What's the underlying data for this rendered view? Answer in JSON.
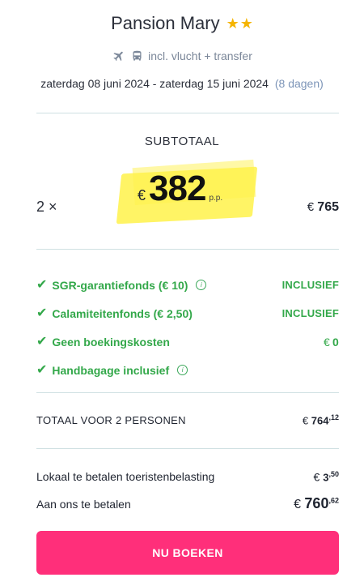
{
  "hotel": {
    "name": "Pansion Mary",
    "stars": 2,
    "star_color": "#f5b400"
  },
  "travel": {
    "icons": [
      "airplane-icon",
      "bus-icon"
    ],
    "label": "incl. vlucht + transfer"
  },
  "dates": {
    "range": "zaterdag 08 juni 2024 - zaterdag 15 juni 2024",
    "duration": "(8 dagen)"
  },
  "subtotal": {
    "label": "SUBTOTAAL",
    "quantity": "2 ×",
    "currency": "€",
    "price_pp": "382",
    "unit": "p.p.",
    "line_total_currency": "€",
    "line_total": "765"
  },
  "features": [
    {
      "label": "SGR-garantiefonds (€ 10)",
      "info": true,
      "value": "INCLUSIEF"
    },
    {
      "label": "Calamiteitenfonds (€ 2,50)",
      "info": false,
      "value": "INCLUSIEF"
    },
    {
      "label": "Geen boekingskosten",
      "info": false,
      "value_currency": "€",
      "value": "0"
    },
    {
      "label": "Handbagage inclusief",
      "info": true,
      "value": ""
    }
  ],
  "total": {
    "label": "TOTAAL VOOR 2 PERSONEN",
    "currency": "€",
    "whole": "764",
    "cents": "12"
  },
  "tax": {
    "label": "Lokaal te betalen toeristenbelasting",
    "currency": "€",
    "whole": "3",
    "cents": "50"
  },
  "pay": {
    "label": "Aan ons te betalen",
    "currency": "€",
    "whole": "760",
    "cents": "62"
  },
  "cta": {
    "label": "NU BOEKEN",
    "color": "#ff2f7a"
  },
  "colors": {
    "accent_green": "#33a84a",
    "divider": "#cfe0e2",
    "highlight": "#fff24a"
  }
}
